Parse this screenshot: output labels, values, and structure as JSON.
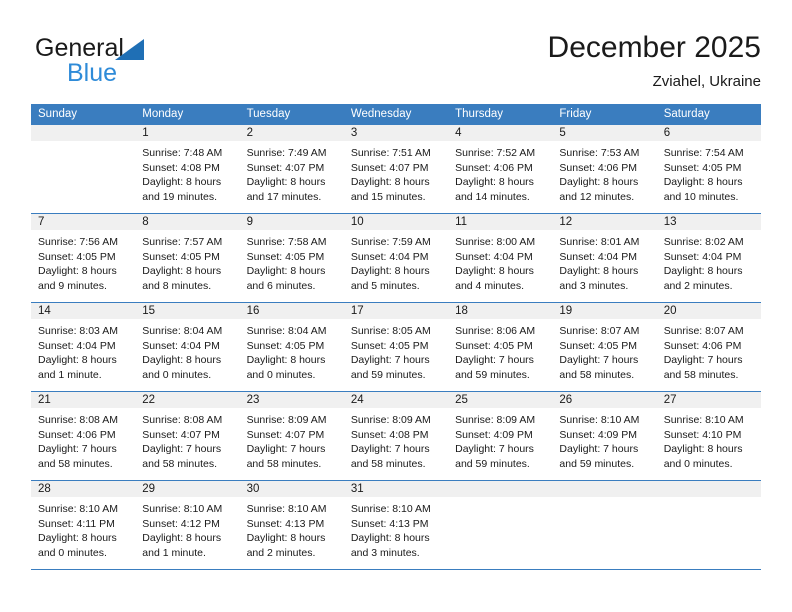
{
  "brand": {
    "name_top": "General",
    "name_bottom": "Blue",
    "triangle_color": "#1f6fb5",
    "blue_text_color": "#2e8bd8"
  },
  "header": {
    "title": "December 2025",
    "subtitle": "Zviahel, Ukraine"
  },
  "theme": {
    "header_row_bg": "#3a7dbf",
    "header_row_text": "#ffffff",
    "daynum_band_bg": "#f0f0f0",
    "week_divider": "#3a7dbf"
  },
  "weekdays": [
    "Sunday",
    "Monday",
    "Tuesday",
    "Wednesday",
    "Thursday",
    "Friday",
    "Saturday"
  ],
  "weeks": [
    [
      {
        "day": "",
        "sunrise": "",
        "sunset": "",
        "daylight_1": "",
        "daylight_2": ""
      },
      {
        "day": "1",
        "sunrise": "Sunrise: 7:48 AM",
        "sunset": "Sunset: 4:08 PM",
        "daylight_1": "Daylight: 8 hours",
        "daylight_2": "and 19 minutes."
      },
      {
        "day": "2",
        "sunrise": "Sunrise: 7:49 AM",
        "sunset": "Sunset: 4:07 PM",
        "daylight_1": "Daylight: 8 hours",
        "daylight_2": "and 17 minutes."
      },
      {
        "day": "3",
        "sunrise": "Sunrise: 7:51 AM",
        "sunset": "Sunset: 4:07 PM",
        "daylight_1": "Daylight: 8 hours",
        "daylight_2": "and 15 minutes."
      },
      {
        "day": "4",
        "sunrise": "Sunrise: 7:52 AM",
        "sunset": "Sunset: 4:06 PM",
        "daylight_1": "Daylight: 8 hours",
        "daylight_2": "and 14 minutes."
      },
      {
        "day": "5",
        "sunrise": "Sunrise: 7:53 AM",
        "sunset": "Sunset: 4:06 PM",
        "daylight_1": "Daylight: 8 hours",
        "daylight_2": "and 12 minutes."
      },
      {
        "day": "6",
        "sunrise": "Sunrise: 7:54 AM",
        "sunset": "Sunset: 4:05 PM",
        "daylight_1": "Daylight: 8 hours",
        "daylight_2": "and 10 minutes."
      }
    ],
    [
      {
        "day": "7",
        "sunrise": "Sunrise: 7:56 AM",
        "sunset": "Sunset: 4:05 PM",
        "daylight_1": "Daylight: 8 hours",
        "daylight_2": "and 9 minutes."
      },
      {
        "day": "8",
        "sunrise": "Sunrise: 7:57 AM",
        "sunset": "Sunset: 4:05 PM",
        "daylight_1": "Daylight: 8 hours",
        "daylight_2": "and 8 minutes."
      },
      {
        "day": "9",
        "sunrise": "Sunrise: 7:58 AM",
        "sunset": "Sunset: 4:05 PM",
        "daylight_1": "Daylight: 8 hours",
        "daylight_2": "and 6 minutes."
      },
      {
        "day": "10",
        "sunrise": "Sunrise: 7:59 AM",
        "sunset": "Sunset: 4:04 PM",
        "daylight_1": "Daylight: 8 hours",
        "daylight_2": "and 5 minutes."
      },
      {
        "day": "11",
        "sunrise": "Sunrise: 8:00 AM",
        "sunset": "Sunset: 4:04 PM",
        "daylight_1": "Daylight: 8 hours",
        "daylight_2": "and 4 minutes."
      },
      {
        "day": "12",
        "sunrise": "Sunrise: 8:01 AM",
        "sunset": "Sunset: 4:04 PM",
        "daylight_1": "Daylight: 8 hours",
        "daylight_2": "and 3 minutes."
      },
      {
        "day": "13",
        "sunrise": "Sunrise: 8:02 AM",
        "sunset": "Sunset: 4:04 PM",
        "daylight_1": "Daylight: 8 hours",
        "daylight_2": "and 2 minutes."
      }
    ],
    [
      {
        "day": "14",
        "sunrise": "Sunrise: 8:03 AM",
        "sunset": "Sunset: 4:04 PM",
        "daylight_1": "Daylight: 8 hours",
        "daylight_2": "and 1 minute."
      },
      {
        "day": "15",
        "sunrise": "Sunrise: 8:04 AM",
        "sunset": "Sunset: 4:04 PM",
        "daylight_1": "Daylight: 8 hours",
        "daylight_2": "and 0 minutes."
      },
      {
        "day": "16",
        "sunrise": "Sunrise: 8:04 AM",
        "sunset": "Sunset: 4:05 PM",
        "daylight_1": "Daylight: 8 hours",
        "daylight_2": "and 0 minutes."
      },
      {
        "day": "17",
        "sunrise": "Sunrise: 8:05 AM",
        "sunset": "Sunset: 4:05 PM",
        "daylight_1": "Daylight: 7 hours",
        "daylight_2": "and 59 minutes."
      },
      {
        "day": "18",
        "sunrise": "Sunrise: 8:06 AM",
        "sunset": "Sunset: 4:05 PM",
        "daylight_1": "Daylight: 7 hours",
        "daylight_2": "and 59 minutes."
      },
      {
        "day": "19",
        "sunrise": "Sunrise: 8:07 AM",
        "sunset": "Sunset: 4:05 PM",
        "daylight_1": "Daylight: 7 hours",
        "daylight_2": "and 58 minutes."
      },
      {
        "day": "20",
        "sunrise": "Sunrise: 8:07 AM",
        "sunset": "Sunset: 4:06 PM",
        "daylight_1": "Daylight: 7 hours",
        "daylight_2": "and 58 minutes."
      }
    ],
    [
      {
        "day": "21",
        "sunrise": "Sunrise: 8:08 AM",
        "sunset": "Sunset: 4:06 PM",
        "daylight_1": "Daylight: 7 hours",
        "daylight_2": "and 58 minutes."
      },
      {
        "day": "22",
        "sunrise": "Sunrise: 8:08 AM",
        "sunset": "Sunset: 4:07 PM",
        "daylight_1": "Daylight: 7 hours",
        "daylight_2": "and 58 minutes."
      },
      {
        "day": "23",
        "sunrise": "Sunrise: 8:09 AM",
        "sunset": "Sunset: 4:07 PM",
        "daylight_1": "Daylight: 7 hours",
        "daylight_2": "and 58 minutes."
      },
      {
        "day": "24",
        "sunrise": "Sunrise: 8:09 AM",
        "sunset": "Sunset: 4:08 PM",
        "daylight_1": "Daylight: 7 hours",
        "daylight_2": "and 58 minutes."
      },
      {
        "day": "25",
        "sunrise": "Sunrise: 8:09 AM",
        "sunset": "Sunset: 4:09 PM",
        "daylight_1": "Daylight: 7 hours",
        "daylight_2": "and 59 minutes."
      },
      {
        "day": "26",
        "sunrise": "Sunrise: 8:10 AM",
        "sunset": "Sunset: 4:09 PM",
        "daylight_1": "Daylight: 7 hours",
        "daylight_2": "and 59 minutes."
      },
      {
        "day": "27",
        "sunrise": "Sunrise: 8:10 AM",
        "sunset": "Sunset: 4:10 PM",
        "daylight_1": "Daylight: 8 hours",
        "daylight_2": "and 0 minutes."
      }
    ],
    [
      {
        "day": "28",
        "sunrise": "Sunrise: 8:10 AM",
        "sunset": "Sunset: 4:11 PM",
        "daylight_1": "Daylight: 8 hours",
        "daylight_2": "and 0 minutes."
      },
      {
        "day": "29",
        "sunrise": "Sunrise: 8:10 AM",
        "sunset": "Sunset: 4:12 PM",
        "daylight_1": "Daylight: 8 hours",
        "daylight_2": "and 1 minute."
      },
      {
        "day": "30",
        "sunrise": "Sunrise: 8:10 AM",
        "sunset": "Sunset: 4:13 PM",
        "daylight_1": "Daylight: 8 hours",
        "daylight_2": "and 2 minutes."
      },
      {
        "day": "31",
        "sunrise": "Sunrise: 8:10 AM",
        "sunset": "Sunset: 4:13 PM",
        "daylight_1": "Daylight: 8 hours",
        "daylight_2": "and 3 minutes."
      },
      {
        "day": "",
        "sunrise": "",
        "sunset": "",
        "daylight_1": "",
        "daylight_2": ""
      },
      {
        "day": "",
        "sunrise": "",
        "sunset": "",
        "daylight_1": "",
        "daylight_2": ""
      },
      {
        "day": "",
        "sunrise": "",
        "sunset": "",
        "daylight_1": "",
        "daylight_2": ""
      }
    ]
  ]
}
